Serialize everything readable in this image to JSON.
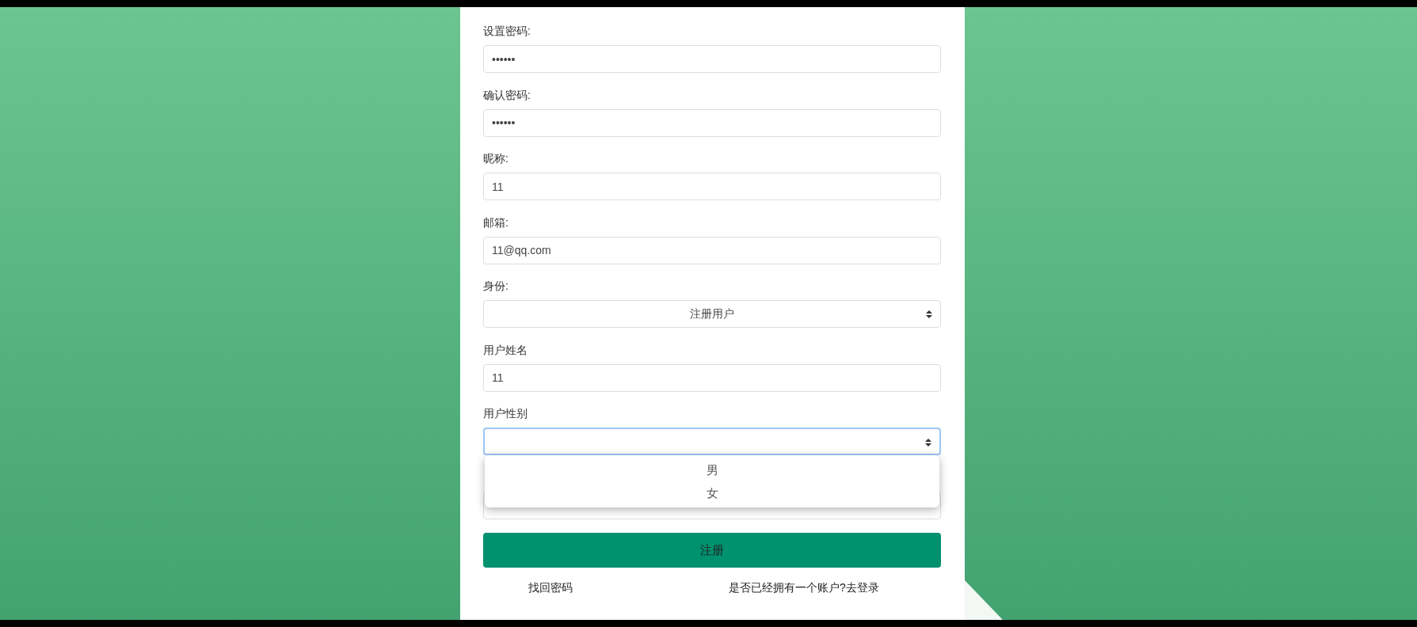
{
  "form": {
    "fields": [
      {
        "kind": "input",
        "label": "设置密码:",
        "value": "••••••"
      },
      {
        "kind": "input",
        "label": "确认密码:",
        "value": "••••••"
      },
      {
        "kind": "input",
        "label": "昵称:",
        "value": "11"
      },
      {
        "kind": "input",
        "label": "邮箱:",
        "value": "11@qq.com"
      },
      {
        "kind": "select",
        "label": "身份:",
        "value": "注册用户",
        "focused": false,
        "expanded": false
      },
      {
        "kind": "input",
        "label": "用户姓名",
        "value": "11"
      },
      {
        "kind": "select",
        "label": "用户性别",
        "focused": true,
        "expanded": true,
        "options": [
          "男",
          "女"
        ]
      },
      {
        "kind": "input"
      }
    ],
    "submit": "注册",
    "links": [
      "找回密码",
      "是否已经拥有一个账户?去登录"
    ]
  }
}
